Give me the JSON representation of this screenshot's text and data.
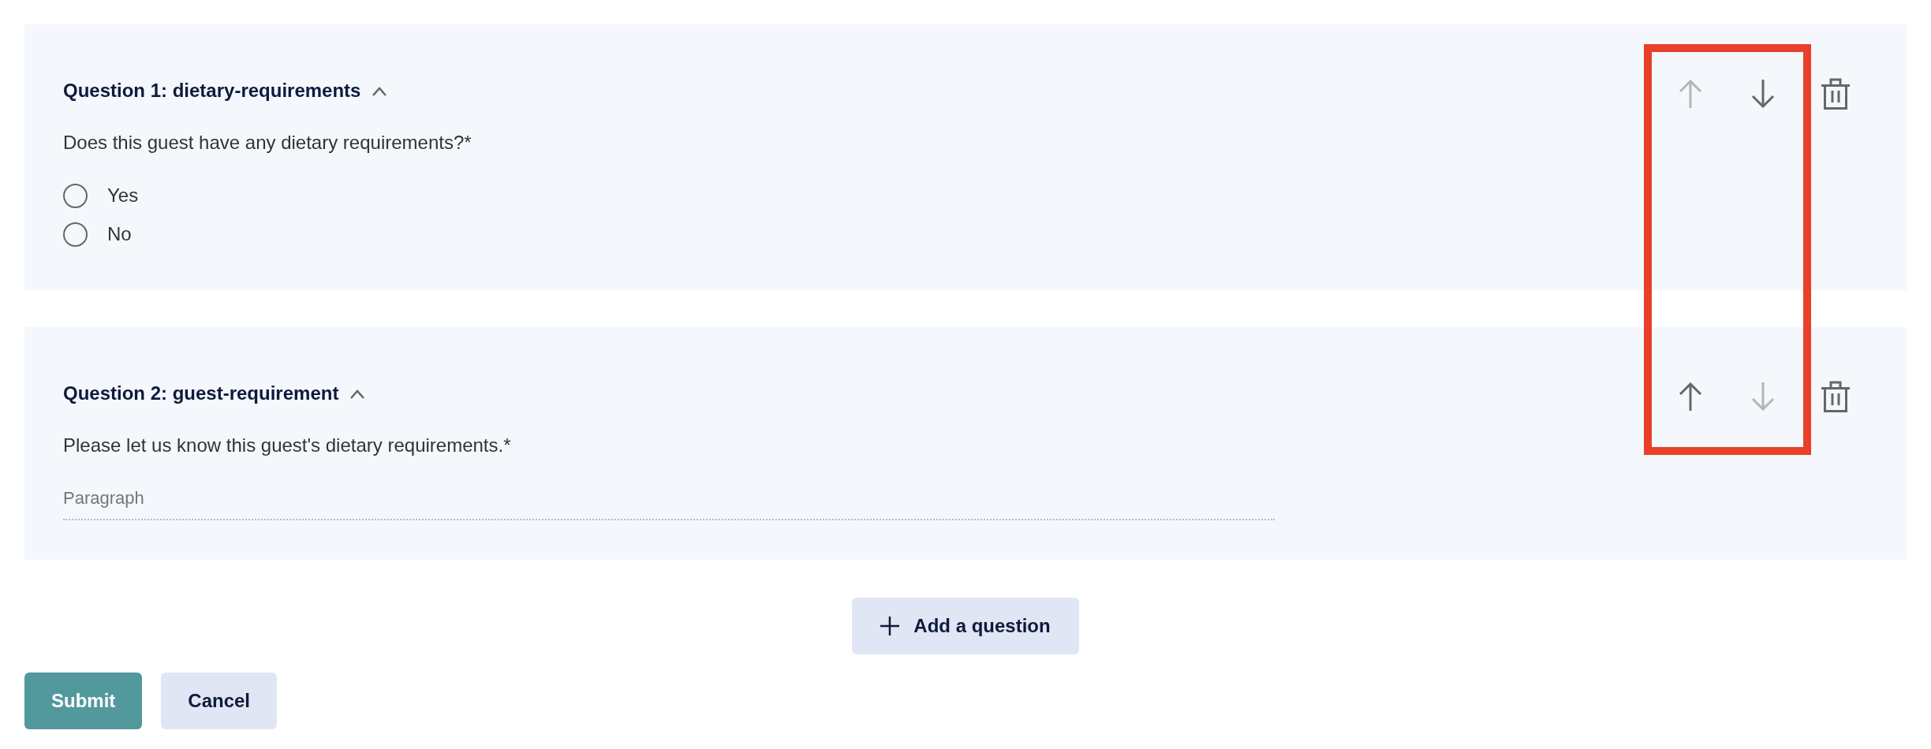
{
  "questions": [
    {
      "title": "Question 1: dietary-requirements",
      "expanded": true,
      "prompt": "Does this guest have any dietary requirements?*",
      "kind": "radio",
      "options": [
        {
          "label": "Yes",
          "selected": false
        },
        {
          "label": "No",
          "selected": false
        }
      ],
      "actions": [
        {
          "kind": "move-up",
          "disabled": true
        },
        {
          "kind": "move-down",
          "disabled": false
        },
        {
          "kind": "delete",
          "disabled": false
        }
      ]
    },
    {
      "title": "Question 2: guest-requirement",
      "expanded": true,
      "prompt": "Please let us know this guest's dietary requirements.*",
      "kind": "paragraph",
      "placeholder": "Paragraph",
      "actions": [
        {
          "kind": "move-up",
          "disabled": false
        },
        {
          "kind": "move-down",
          "disabled": true
        },
        {
          "kind": "delete",
          "disabled": false
        }
      ]
    }
  ],
  "add_question": {
    "label": "Add a question"
  },
  "form_buttons": [
    {
      "label": "Submit",
      "kind": "primary"
    },
    {
      "label": "Cancel",
      "kind": "secondary"
    }
  ],
  "annotation": {
    "kind": "highlight-frame"
  }
}
